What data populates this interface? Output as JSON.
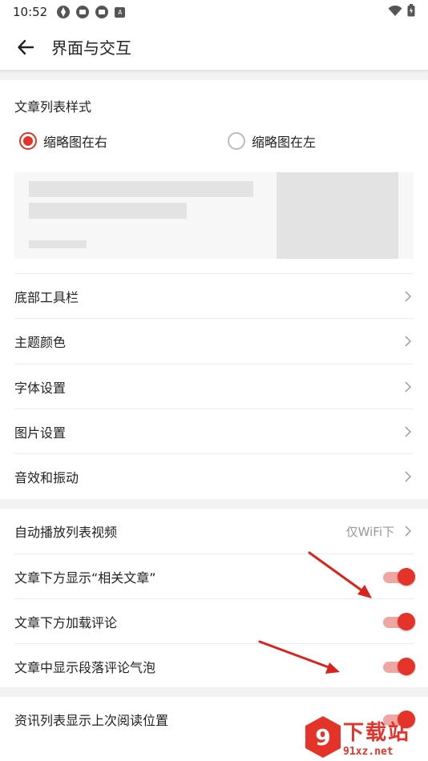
{
  "status_bar": {
    "time": "10:52",
    "icons": [
      "aperture-icon",
      "app-icon-1",
      "app-icon-2",
      "a-badge-icon"
    ],
    "icon_letters": [
      "",
      "",
      "",
      "A"
    ],
    "right_icons": [
      "wifi-icon",
      "battery-icon"
    ]
  },
  "app_bar": {
    "title": "界面与交互"
  },
  "list_style": {
    "title": "文章列表样式",
    "options": [
      {
        "label": "缩略图在右",
        "selected": true
      },
      {
        "label": "缩略图在左",
        "selected": false
      }
    ]
  },
  "settings_group1": [
    {
      "label": "底部工具栏"
    },
    {
      "label": "主题颜色"
    },
    {
      "label": "字体设置"
    },
    {
      "label": "图片设置"
    },
    {
      "label": "音效和振动"
    }
  ],
  "settings_group2": {
    "autoplay": {
      "label": "自动播放列表视频",
      "value": "仅WiFi下"
    },
    "toggles": [
      {
        "label": "文章下方显示“相关文章”",
        "on": true
      },
      {
        "label": "文章下方加载评论",
        "on": true
      },
      {
        "label": "文章中显示段落评论气泡",
        "on": true
      }
    ]
  },
  "settings_group3": {
    "toggles": [
      {
        "label": "资讯列表显示上次阅读位置",
        "on": true
      }
    ]
  },
  "watermark": {
    "brand": "下载站",
    "url": "91xz.net",
    "logo_text": "9"
  },
  "colors": {
    "accent": "#e5332a",
    "accent_light": "#eea7a3",
    "background": "#f2f2f2"
  }
}
